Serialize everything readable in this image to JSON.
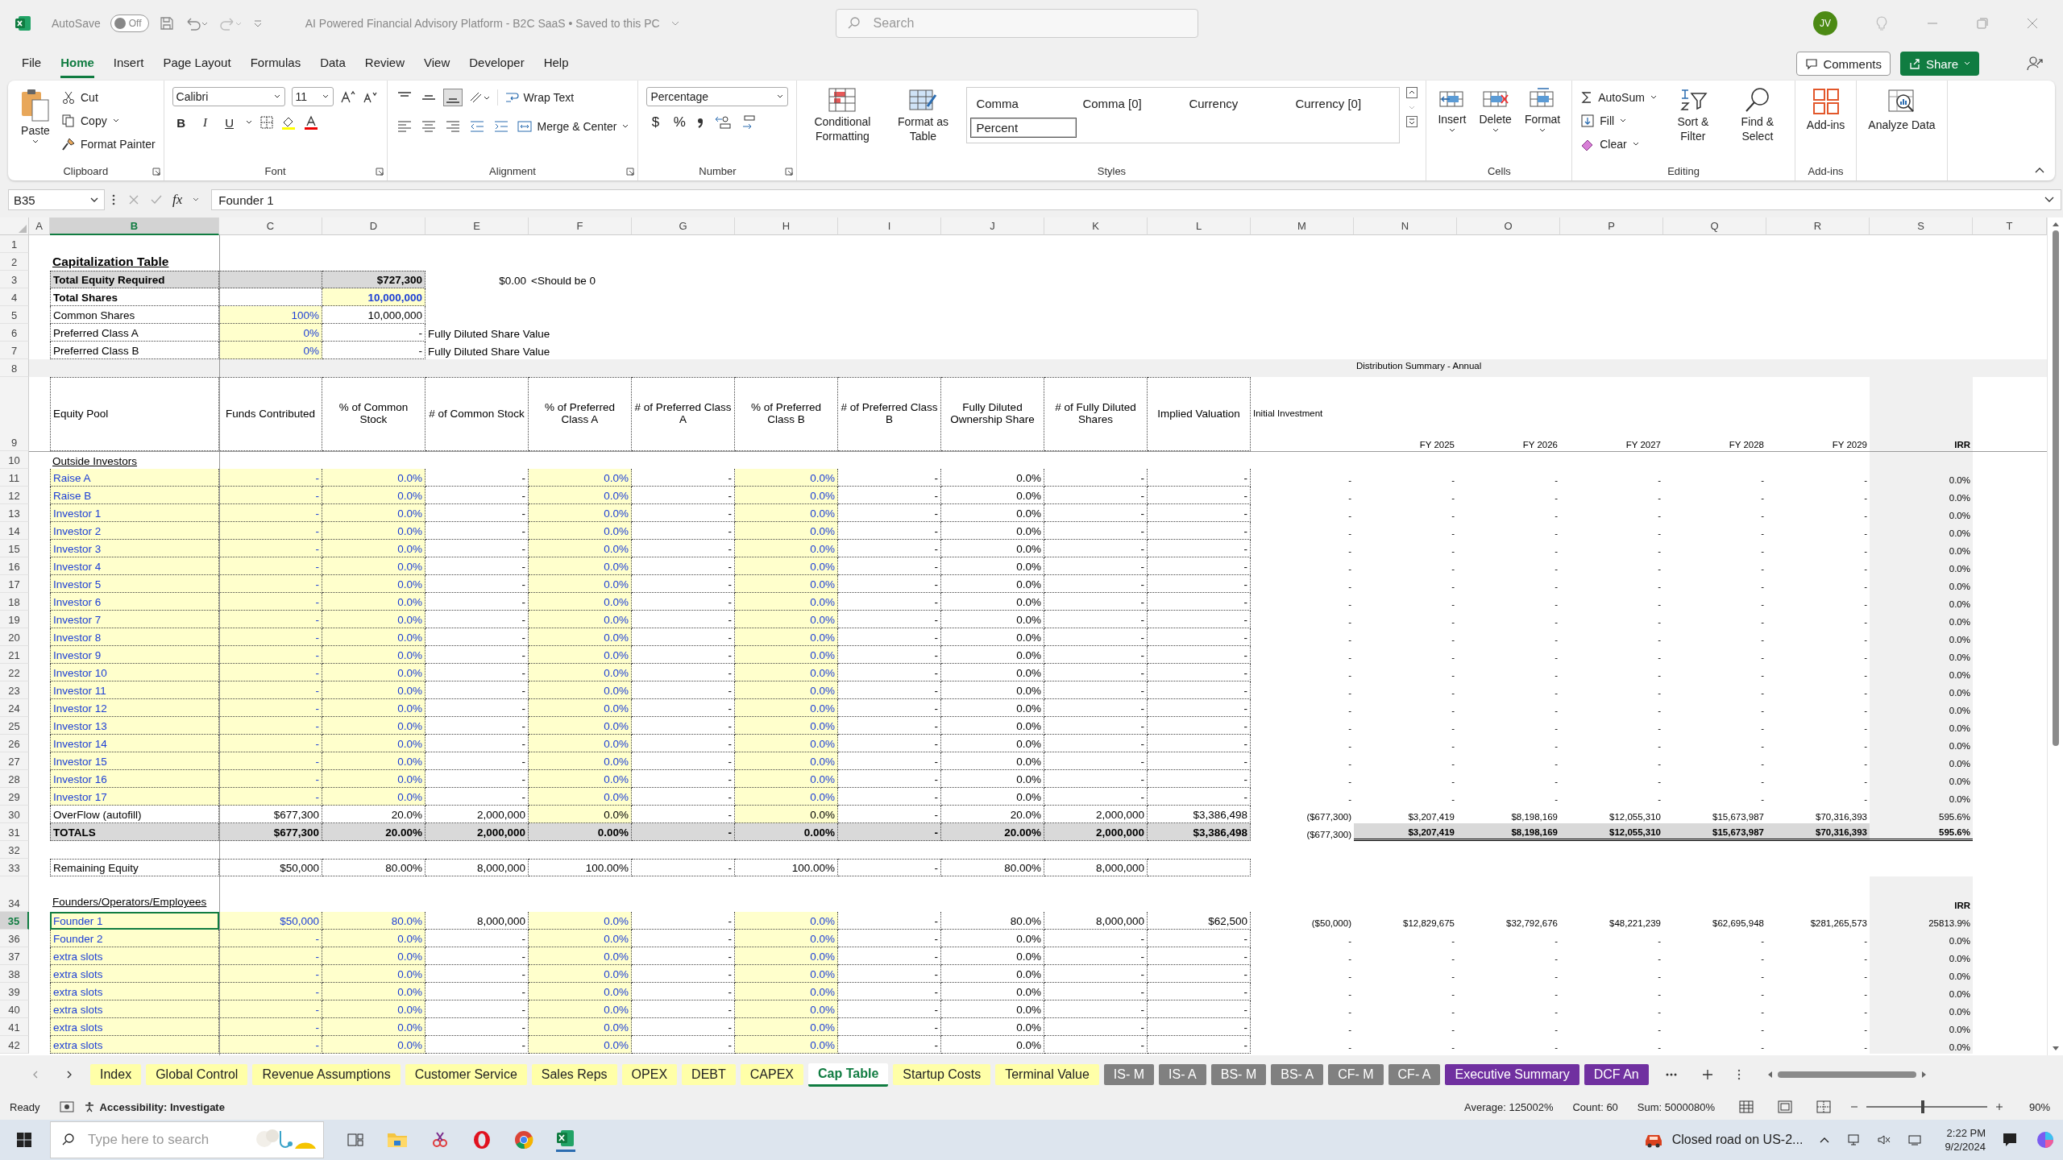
{
  "titlebar": {
    "autosave_label": "AutoSave",
    "autosave": {
      "on": false,
      "label": "Off"
    },
    "title": "AI Powered Financial Advisory Platform - B2C SaaS • Saved to this PC",
    "search": {
      "placeholder": "Search"
    },
    "avatar": "JV"
  },
  "menu": [
    {
      "label": "File",
      "selected": false
    },
    {
      "label": "Home",
      "selected": true
    },
    {
      "label": "Insert",
      "selected": false
    },
    {
      "label": "Page Layout",
      "selected": false
    },
    {
      "label": "Formulas",
      "selected": false
    },
    {
      "label": "Data",
      "selected": false
    },
    {
      "label": "Review",
      "selected": false
    },
    {
      "label": "View",
      "selected": false
    },
    {
      "label": "Developer",
      "selected": false
    },
    {
      "label": "Help",
      "selected": false
    }
  ],
  "actions": {
    "comments": "Comments",
    "share": "Share"
  },
  "ribbon": [
    {
      "kind": "clipboard",
      "label": "Clipboard",
      "items": [
        {
          "label": "Paste"
        },
        {
          "label": "Cut"
        },
        {
          "label": "Copy"
        },
        {
          "label": "Format Painter"
        }
      ]
    },
    {
      "kind": "font",
      "label": "Font",
      "font": "Calibri",
      "size": "11",
      "styles": [
        "B",
        "I",
        "U"
      ]
    },
    {
      "kind": "alignment",
      "label": "Alignment",
      "items": [
        {
          "label": "Wrap Text"
        },
        {
          "label": "Merge & Center"
        }
      ]
    },
    {
      "kind": "number",
      "label": "Number",
      "format": "Percentage",
      "symbols": [
        "$",
        "%"
      ]
    },
    {
      "kind": "styles",
      "label": "Styles",
      "items": [
        {
          "label": "Conditional Formatting"
        },
        {
          "label": "Format as Table"
        }
      ],
      "gallery": [
        {
          "label": "Comma",
          "selected": false
        },
        {
          "label": "Comma [0]",
          "selected": false
        },
        {
          "label": "Currency",
          "selected": false
        },
        {
          "label": "Currency [0]",
          "selected": false
        },
        {
          "label": "Percent",
          "selected": true
        }
      ]
    },
    {
      "kind": "cells",
      "label": "Cells",
      "items": [
        {
          "label": "Insert"
        },
        {
          "label": "Delete"
        },
        {
          "label": "Format"
        }
      ]
    },
    {
      "kind": "editing",
      "label": "Editing",
      "items": [
        {
          "label": "AutoSum"
        },
        {
          "label": "Fill"
        },
        {
          "label": "Clear"
        },
        {
          "label": "Sort & Filter"
        },
        {
          "label": "Find & Select"
        }
      ]
    },
    {
      "kind": "addins",
      "label": "Add-ins",
      "items": [
        {
          "label": "Add-ins"
        }
      ]
    },
    {
      "kind": "analyze",
      "items": [
        {
          "label": "Analyze Data"
        }
      ]
    }
  ],
  "formula_bar": {
    "name_box": "B35",
    "function_label": "fx",
    "content": "Founder 1"
  },
  "sheet": {
    "columns": [
      {
        "label": "A",
        "selected": false
      },
      {
        "label": "B",
        "selected": true
      },
      {
        "label": "C",
        "selected": false
      },
      {
        "label": "D",
        "selected": false
      },
      {
        "label": "E",
        "selected": false
      },
      {
        "label": "F",
        "selected": false
      },
      {
        "label": "G",
        "selected": false
      },
      {
        "label": "H",
        "selected": false
      },
      {
        "label": "I",
        "selected": false
      },
      {
        "label": "J",
        "selected": false
      },
      {
        "label": "K",
        "selected": false
      },
      {
        "label": "L",
        "selected": false
      },
      {
        "label": "M",
        "selected": false
      },
      {
        "label": "N",
        "selected": false
      },
      {
        "label": "O",
        "selected": false
      },
      {
        "label": "P",
        "selected": false
      },
      {
        "label": "Q",
        "selected": false
      },
      {
        "label": "R",
        "selected": false
      },
      {
        "label": "S",
        "selected": false
      },
      {
        "label": "T",
        "selected": false
      }
    ],
    "rows": [
      {
        "num": "1",
        "kind": "blank",
        "selected": false,
        "cells": []
      },
      {
        "num": "2",
        "kind": "title",
        "selected": false,
        "cells": [
          null,
          "Capitalization Table"
        ]
      },
      {
        "num": "3",
        "kind": "required",
        "selected": false,
        "cells": [
          null,
          "Total Equity Required",
          null,
          "$727,300",
          "$0.00",
          "<Should be 0"
        ]
      },
      {
        "num": "4",
        "kind": "shares",
        "selected": false,
        "cells": [
          null,
          "Total Shares",
          null,
          "10,000,000"
        ]
      },
      {
        "num": "5",
        "kind": "split",
        "selected": false,
        "cells": [
          null,
          "Common Shares",
          "100%",
          "10,000,000"
        ]
      },
      {
        "num": "6",
        "kind": "split",
        "selected": false,
        "cells": [
          null,
          "Preferred Class A",
          "0%",
          "-",
          "Fully Diluted Share Value"
        ]
      },
      {
        "num": "7",
        "kind": "split",
        "selected": false,
        "cells": [
          null,
          "Preferred Class B",
          "0%",
          "-",
          "Fully Diluted Share Value"
        ]
      },
      {
        "num": "8",
        "kind": "band",
        "selected": false,
        "cells": [
          null,
          null,
          null,
          null,
          null,
          null,
          null,
          null,
          null,
          null,
          null,
          null,
          null,
          "Distribution Summary - Annual"
        ]
      },
      {
        "num": "9",
        "kind": "header",
        "selected": false,
        "cells": [
          null,
          "Equity Pool",
          "Funds Contributed",
          "% of Common Stock",
          "# of Common Stock",
          "% of Preferred Class A",
          "# of Preferred Class A",
          "% of Preferred Class B",
          "# of Preferred Class B",
          "Fully Diluted Ownership Share",
          "# of Fully Diluted Shares",
          "Implied Valuation",
          "Initial Investment",
          "FY 2025",
          "FY 2026",
          "FY 2027",
          "FY 2028",
          "FY 2029",
          "IRR"
        ]
      },
      {
        "num": "10",
        "kind": "section",
        "selected": false,
        "cells": [
          null,
          "Outside Investors"
        ]
      },
      {
        "num": "11",
        "kind": "input",
        "selected": false,
        "cells": [
          null,
          "Raise A",
          "-",
          "0.0%",
          "-",
          "0.0%",
          "-",
          "0.0%",
          "-",
          "0.0%",
          "-",
          "-",
          "-",
          "-",
          "-",
          "-",
          "-",
          "-",
          "0.0%"
        ]
      },
      {
        "num": "12",
        "kind": "input",
        "selected": false,
        "cells": [
          null,
          "Raise B",
          "-",
          "0.0%",
          "-",
          "0.0%",
          "-",
          "0.0%",
          "-",
          "0.0%",
          "-",
          "-",
          "-",
          "-",
          "-",
          "-",
          "-",
          "-",
          "0.0%"
        ]
      },
      {
        "num": "13",
        "kind": "input",
        "selected": false,
        "cells": [
          null,
          "Investor 1",
          "-",
          "0.0%",
          "-",
          "0.0%",
          "-",
          "0.0%",
          "-",
          "0.0%",
          "-",
          "-",
          "-",
          "-",
          "-",
          "-",
          "-",
          "-",
          "0.0%"
        ]
      },
      {
        "num": "14",
        "kind": "input",
        "selected": false,
        "cells": [
          null,
          "Investor 2",
          "-",
          "0.0%",
          "-",
          "0.0%",
          "-",
          "0.0%",
          "-",
          "0.0%",
          "-",
          "-",
          "-",
          "-",
          "-",
          "-",
          "-",
          "-",
          "0.0%"
        ]
      },
      {
        "num": "15",
        "kind": "input",
        "selected": false,
        "cells": [
          null,
          "Investor 3",
          "-",
          "0.0%",
          "-",
          "0.0%",
          "-",
          "0.0%",
          "-",
          "0.0%",
          "-",
          "-",
          "-",
          "-",
          "-",
          "-",
          "-",
          "-",
          "0.0%"
        ]
      },
      {
        "num": "16",
        "kind": "input",
        "selected": false,
        "cells": [
          null,
          "Investor 4",
          "-",
          "0.0%",
          "-",
          "0.0%",
          "-",
          "0.0%",
          "-",
          "0.0%",
          "-",
          "-",
          "-",
          "-",
          "-",
          "-",
          "-",
          "-",
          "0.0%"
        ]
      },
      {
        "num": "17",
        "kind": "input",
        "selected": false,
        "cells": [
          null,
          "Investor 5",
          "-",
          "0.0%",
          "-",
          "0.0%",
          "-",
          "0.0%",
          "-",
          "0.0%",
          "-",
          "-",
          "-",
          "-",
          "-",
          "-",
          "-",
          "-",
          "0.0%"
        ]
      },
      {
        "num": "18",
        "kind": "input",
        "selected": false,
        "cells": [
          null,
          "Investor 6",
          "-",
          "0.0%",
          "-",
          "0.0%",
          "-",
          "0.0%",
          "-",
          "0.0%",
          "-",
          "-",
          "-",
          "-",
          "-",
          "-",
          "-",
          "-",
          "0.0%"
        ]
      },
      {
        "num": "19",
        "kind": "input",
        "selected": false,
        "cells": [
          null,
          "Investor 7",
          "-",
          "0.0%",
          "-",
          "0.0%",
          "-",
          "0.0%",
          "-",
          "0.0%",
          "-",
          "-",
          "-",
          "-",
          "-",
          "-",
          "-",
          "-",
          "0.0%"
        ]
      },
      {
        "num": "20",
        "kind": "input",
        "selected": false,
        "cells": [
          null,
          "Investor 8",
          "-",
          "0.0%",
          "-",
          "0.0%",
          "-",
          "0.0%",
          "-",
          "0.0%",
          "-",
          "-",
          "-",
          "-",
          "-",
          "-",
          "-",
          "-",
          "0.0%"
        ]
      },
      {
        "num": "21",
        "kind": "input",
        "selected": false,
        "cells": [
          null,
          "Investor 9",
          "-",
          "0.0%",
          "-",
          "0.0%",
          "-",
          "0.0%",
          "-",
          "0.0%",
          "-",
          "-",
          "-",
          "-",
          "-",
          "-",
          "-",
          "-",
          "0.0%"
        ]
      },
      {
        "num": "22",
        "kind": "input",
        "selected": false,
        "cells": [
          null,
          "Investor 10",
          "-",
          "0.0%",
          "-",
          "0.0%",
          "-",
          "0.0%",
          "-",
          "0.0%",
          "-",
          "-",
          "-",
          "-",
          "-",
          "-",
          "-",
          "-",
          "0.0%"
        ]
      },
      {
        "num": "23",
        "kind": "input",
        "selected": false,
        "cells": [
          null,
          "Investor 11",
          "-",
          "0.0%",
          "-",
          "0.0%",
          "-",
          "0.0%",
          "-",
          "0.0%",
          "-",
          "-",
          "-",
          "-",
          "-",
          "-",
          "-",
          "-",
          "0.0%"
        ]
      },
      {
        "num": "24",
        "kind": "input",
        "selected": false,
        "cells": [
          null,
          "Investor 12",
          "-",
          "0.0%",
          "-",
          "0.0%",
          "-",
          "0.0%",
          "-",
          "0.0%",
          "-",
          "-",
          "-",
          "-",
          "-",
          "-",
          "-",
          "-",
          "0.0%"
        ]
      },
      {
        "num": "25",
        "kind": "input",
        "selected": false,
        "cells": [
          null,
          "Investor 13",
          "-",
          "0.0%",
          "-",
          "0.0%",
          "-",
          "0.0%",
          "-",
          "0.0%",
          "-",
          "-",
          "-",
          "-",
          "-",
          "-",
          "-",
          "-",
          "0.0%"
        ]
      },
      {
        "num": "26",
        "kind": "input",
        "selected": false,
        "cells": [
          null,
          "Investor 14",
          "-",
          "0.0%",
          "-",
          "0.0%",
          "-",
          "0.0%",
          "-",
          "0.0%",
          "-",
          "-",
          "-",
          "-",
          "-",
          "-",
          "-",
          "-",
          "0.0%"
        ]
      },
      {
        "num": "27",
        "kind": "input",
        "selected": false,
        "cells": [
          null,
          "Investor 15",
          "-",
          "0.0%",
          "-",
          "0.0%",
          "-",
          "0.0%",
          "-",
          "0.0%",
          "-",
          "-",
          "-",
          "-",
          "-",
          "-",
          "-",
          "-",
          "0.0%"
        ]
      },
      {
        "num": "28",
        "kind": "input",
        "selected": false,
        "cells": [
          null,
          "Investor 16",
          "-",
          "0.0%",
          "-",
          "0.0%",
          "-",
          "0.0%",
          "-",
          "0.0%",
          "-",
          "-",
          "-",
          "-",
          "-",
          "-",
          "-",
          "-",
          "0.0%"
        ]
      },
      {
        "num": "29",
        "kind": "input",
        "selected": false,
        "cells": [
          null,
          "Investor 17",
          "-",
          "0.0%",
          "-",
          "0.0%",
          "-",
          "0.0%",
          "-",
          "0.0%",
          "-",
          "-",
          "-",
          "-",
          "-",
          "-",
          "-",
          "-",
          "0.0%"
        ]
      },
      {
        "num": "30",
        "kind": "overflow",
        "selected": false,
        "cells": [
          null,
          "OverFlow (autofill)",
          "$677,300",
          "20.0%",
          "2,000,000",
          "0.0%",
          "-",
          "0.0%",
          "-",
          "20.0%",
          "2,000,000",
          "$3,386,498",
          "($677,300)",
          "$3,207,419",
          "$8,198,169",
          "$12,055,310",
          "$15,673,987",
          "$70,316,393",
          "595.6%"
        ]
      },
      {
        "num": "31",
        "kind": "total",
        "selected": false,
        "cells": [
          null,
          "TOTALS",
          "$677,300",
          "20.00%",
          "2,000,000",
          "0.00%",
          "-",
          "0.00%",
          "-",
          "20.00%",
          "2,000,000",
          "$3,386,498",
          "($677,300)",
          "$3,207,419",
          "$8,198,169",
          "$12,055,310",
          "$15,673,987",
          "$70,316,393",
          "595.6%"
        ]
      },
      {
        "num": "32",
        "kind": "blank",
        "selected": false,
        "cells": []
      },
      {
        "num": "33",
        "kind": "remaining",
        "selected": false,
        "cells": [
          null,
          "Remaining Equity",
          "$50,000",
          "80.00%",
          "8,000,000",
          "100.00%",
          "-",
          "100.00%",
          "-",
          "80.00%",
          "8,000,000"
        ]
      },
      {
        "num": "34",
        "kind": "group",
        "selected": false,
        "cells": [
          null,
          "Founders/Operators/Employees",
          null,
          null,
          null,
          null,
          null,
          null,
          null,
          null,
          null,
          null,
          null,
          null,
          null,
          null,
          null,
          null,
          "IRR"
        ]
      },
      {
        "num": "35",
        "kind": "input",
        "selected": true,
        "cells": [
          null,
          "Founder 1",
          "$50,000",
          "80.0%",
          "8,000,000",
          "0.0%",
          "-",
          "0.0%",
          "-",
          "80.0%",
          "8,000,000",
          "$62,500",
          "($50,000)",
          "$12,829,675",
          "$32,792,676",
          "$48,221,239",
          "$62,695,948",
          "$281,265,573",
          "25813.9%"
        ]
      },
      {
        "num": "36",
        "kind": "input",
        "selected": false,
        "cells": [
          null,
          "Founder 2",
          "-",
          "0.0%",
          "-",
          "0.0%",
          "-",
          "0.0%",
          "-",
          "0.0%",
          "-",
          "-",
          "-",
          "-",
          "-",
          "-",
          "-",
          "-",
          "0.0%"
        ]
      },
      {
        "num": "37",
        "kind": "input",
        "selected": false,
        "cells": [
          null,
          "extra slots",
          "-",
          "0.0%",
          "-",
          "0.0%",
          "-",
          "0.0%",
          "-",
          "0.0%",
          "-",
          "-",
          "-",
          "-",
          "-",
          "-",
          "-",
          "-",
          "0.0%"
        ]
      },
      {
        "num": "38",
        "kind": "input",
        "selected": false,
        "cells": [
          null,
          "extra slots",
          "-",
          "0.0%",
          "-",
          "0.0%",
          "-",
          "0.0%",
          "-",
          "0.0%",
          "-",
          "-",
          "-",
          "-",
          "-",
          "-",
          "-",
          "-",
          "0.0%"
        ]
      },
      {
        "num": "39",
        "kind": "input",
        "selected": false,
        "cells": [
          null,
          "extra slots",
          "-",
          "0.0%",
          "-",
          "0.0%",
          "-",
          "0.0%",
          "-",
          "0.0%",
          "-",
          "-",
          "-",
          "-",
          "-",
          "-",
          "-",
          "-",
          "0.0%"
        ]
      },
      {
        "num": "40",
        "kind": "input",
        "selected": false,
        "cells": [
          null,
          "extra slots",
          "-",
          "0.0%",
          "-",
          "0.0%",
          "-",
          "0.0%",
          "-",
          "0.0%",
          "-",
          "-",
          "-",
          "-",
          "-",
          "-",
          "-",
          "-",
          "0.0%"
        ]
      },
      {
        "num": "41",
        "kind": "input",
        "selected": false,
        "cells": [
          null,
          "extra slots",
          "-",
          "0.0%",
          "-",
          "0.0%",
          "-",
          "0.0%",
          "-",
          "0.0%",
          "-",
          "-",
          "-",
          "-",
          "-",
          "-",
          "-",
          "-",
          "0.0%"
        ]
      },
      {
        "num": "42",
        "kind": "input",
        "selected": false,
        "cells": [
          null,
          "extra slots",
          "-",
          "0.0%",
          "-",
          "0.0%",
          "-",
          "0.0%",
          "-",
          "0.0%",
          "-",
          "-",
          "-",
          "-",
          "-",
          "-",
          "-",
          "-",
          "0.0%"
        ]
      }
    ]
  },
  "sheet_tabs": [
    {
      "label": "Index",
      "selected": false,
      "color": "#ffffa8"
    },
    {
      "label": "Global Control",
      "selected": false,
      "color": "#ffffa8"
    },
    {
      "label": "Revenue Assumptions",
      "selected": false,
      "color": "#ffffa8"
    },
    {
      "label": "Customer Service",
      "selected": false,
      "color": "#ffffa8"
    },
    {
      "label": "Sales Reps",
      "selected": false,
      "color": "#ffffa8"
    },
    {
      "label": "OPEX",
      "selected": false,
      "color": "#ffffa8"
    },
    {
      "label": "DEBT",
      "selected": false,
      "color": "#ffffa8"
    },
    {
      "label": "CAPEX",
      "selected": false,
      "color": "#ffffa8"
    },
    {
      "label": "Cap Table",
      "selected": true
    },
    {
      "label": "Startup Costs",
      "selected": false,
      "color": "#ffffa8"
    },
    {
      "label": "Terminal Value",
      "selected": false,
      "color": "#ffffa8"
    },
    {
      "label": "IS- M",
      "selected": false,
      "color": "#808080"
    },
    {
      "label": "IS- A",
      "selected": false,
      "color": "#808080"
    },
    {
      "label": "BS- M",
      "selected": false,
      "color": "#808080"
    },
    {
      "label": "BS- A",
      "selected": false,
      "color": "#808080"
    },
    {
      "label": "CF- M",
      "selected": false,
      "color": "#808080"
    },
    {
      "label": "CF- A",
      "selected": false,
      "color": "#808080"
    },
    {
      "label": "Executive Summary",
      "selected": false,
      "color": "#7030a0"
    },
    {
      "label": "DCF An",
      "selected": false,
      "color": "#7030a0"
    }
  ],
  "status_bar": {
    "mode": "Ready",
    "accessibility": "Accessibility: Investigate",
    "average": "Average: 125002%",
    "count": "Count: 60",
    "sum": "Sum: 5000080%",
    "zoom": {
      "level": 0.47,
      "reading": "90%"
    }
  },
  "taskbar": {
    "search": {
      "placeholder": "Type here to search"
    },
    "weather": "Closed road on US-2...",
    "time": "2:22 PM",
    "date": "9/2/2024"
  }
}
